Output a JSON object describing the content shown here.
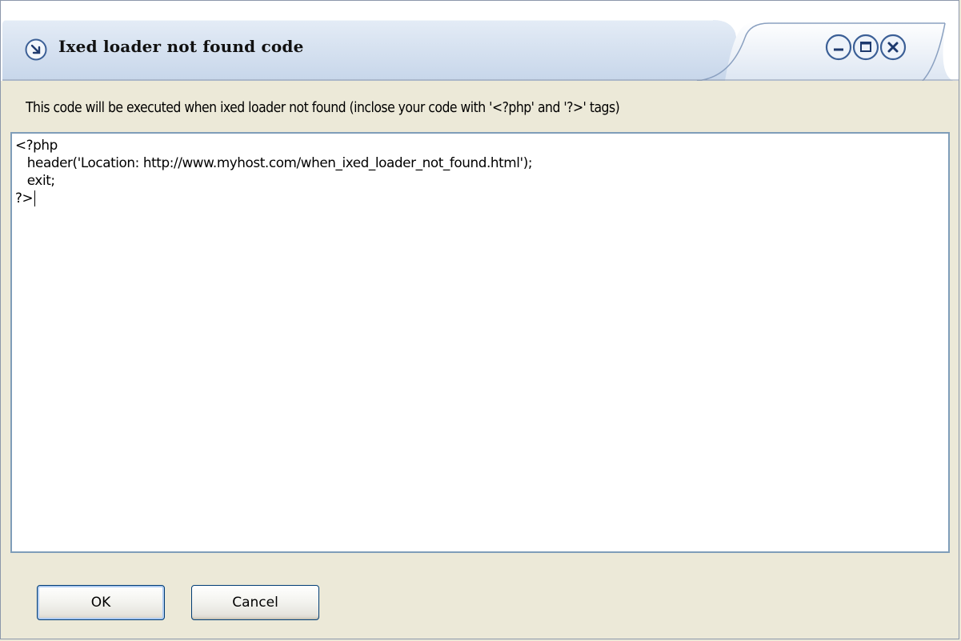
{
  "window": {
    "title": "Ixed loader not found code"
  },
  "title_controls": [
    "minimize-icon",
    "maximize-icon",
    "close-icon"
  ],
  "description": "This code will be executed when ixed loader not found (inclose your code with '<?php' and  '?>' tags)",
  "editor": {
    "value": "<?php\n   header('Location: http://www.myhost.com/when_ixed_loader_not_found.html');\n   exit;\n?>"
  },
  "footer": {
    "ok_label": "OK",
    "cancel_label": "Cancel"
  },
  "colors": {
    "accent": "#3b5f96",
    "border": "#7f9db9",
    "face": "#ece9d8"
  }
}
